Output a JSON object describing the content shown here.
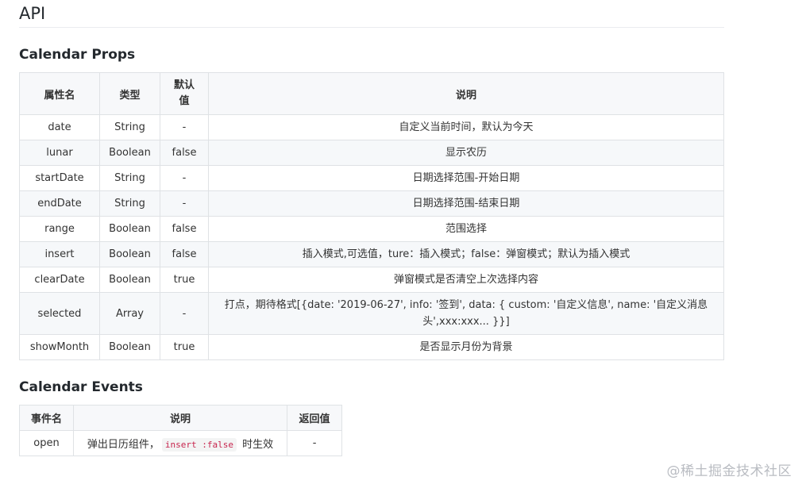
{
  "page": {
    "title": "API"
  },
  "props_section": {
    "title": "Calendar Props",
    "headers": [
      "属性名",
      "类型",
      "默认\n值",
      "说明"
    ],
    "header_default_line1": "默认",
    "header_default_line2": "值",
    "rows": [
      {
        "name": "date",
        "type": "String",
        "default": "-",
        "desc": "自定义当前时间，默认为今天"
      },
      {
        "name": "lunar",
        "type": "Boolean",
        "default": "false",
        "desc": "显示农历"
      },
      {
        "name": "startDate",
        "type": "String",
        "default": "-",
        "desc": "日期选择范围-开始日期"
      },
      {
        "name": "endDate",
        "type": "String",
        "default": "-",
        "desc": "日期选择范围-结束日期"
      },
      {
        "name": "range",
        "type": "Boolean",
        "default": "false",
        "desc": "范围选择"
      },
      {
        "name": "insert",
        "type": "Boolean",
        "default": "false",
        "desc": "插入模式,可选值，ture：插入模式；false：弹窗模式；默认为插入模式"
      },
      {
        "name": "clearDate",
        "type": "Boolean",
        "default": "true",
        "desc": "弹窗模式是否清空上次选择内容"
      },
      {
        "name": "selected",
        "type": "Array",
        "default": "-",
        "desc": "打点，期待格式[{date: '2019-06-27', info: '签到', data: { custom: '自定义信息', name: '自定义消息头',xxx:xxx... }}]"
      },
      {
        "name": "showMonth",
        "type": "Boolean",
        "default": "true",
        "desc": "是否显示月份为背景"
      }
    ]
  },
  "events_section": {
    "title": "Calendar Events",
    "headers": [
      "事件名",
      "说明",
      "返回值"
    ],
    "rows": [
      {
        "name": "open",
        "desc_before": "弹出日历组件，",
        "code": "insert :false",
        "desc_after": " 时生效",
        "returns": "-"
      }
    ]
  },
  "watermark": "@稀土掘金技术社区"
}
